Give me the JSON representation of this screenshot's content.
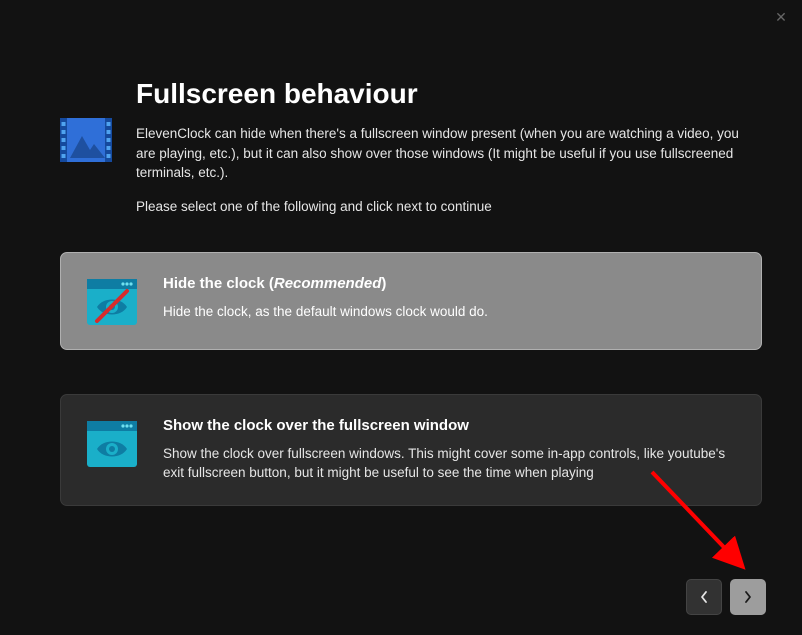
{
  "window": {
    "close_glyph": "✕"
  },
  "header": {
    "title": "Fullscreen behaviour",
    "description": "ElevenClock can hide when there's a fullscreen window present (when you are watching a video, you are playing, etc.), but it can also show over those windows (It might be useful if you use fullscreened terminals, etc.).",
    "instruction": "Please select one of the following and click next to continue"
  },
  "options": [
    {
      "title_prefix": "Hide the clock (",
      "title_em": "Recommended",
      "title_suffix": ")",
      "subtitle": "Hide the clock, as the default windows clock would do.",
      "selected": true
    },
    {
      "title_prefix": "Show the clock over the fullscreen window",
      "title_em": "",
      "title_suffix": "",
      "subtitle": "Show the clock over fullscreen windows. This might cover some in-app controls, like youtube's exit fullscreen button, but it might be useful to see the time when playing",
      "selected": false
    }
  ],
  "nav": {
    "back_glyph": "‹",
    "next_glyph": "›"
  }
}
